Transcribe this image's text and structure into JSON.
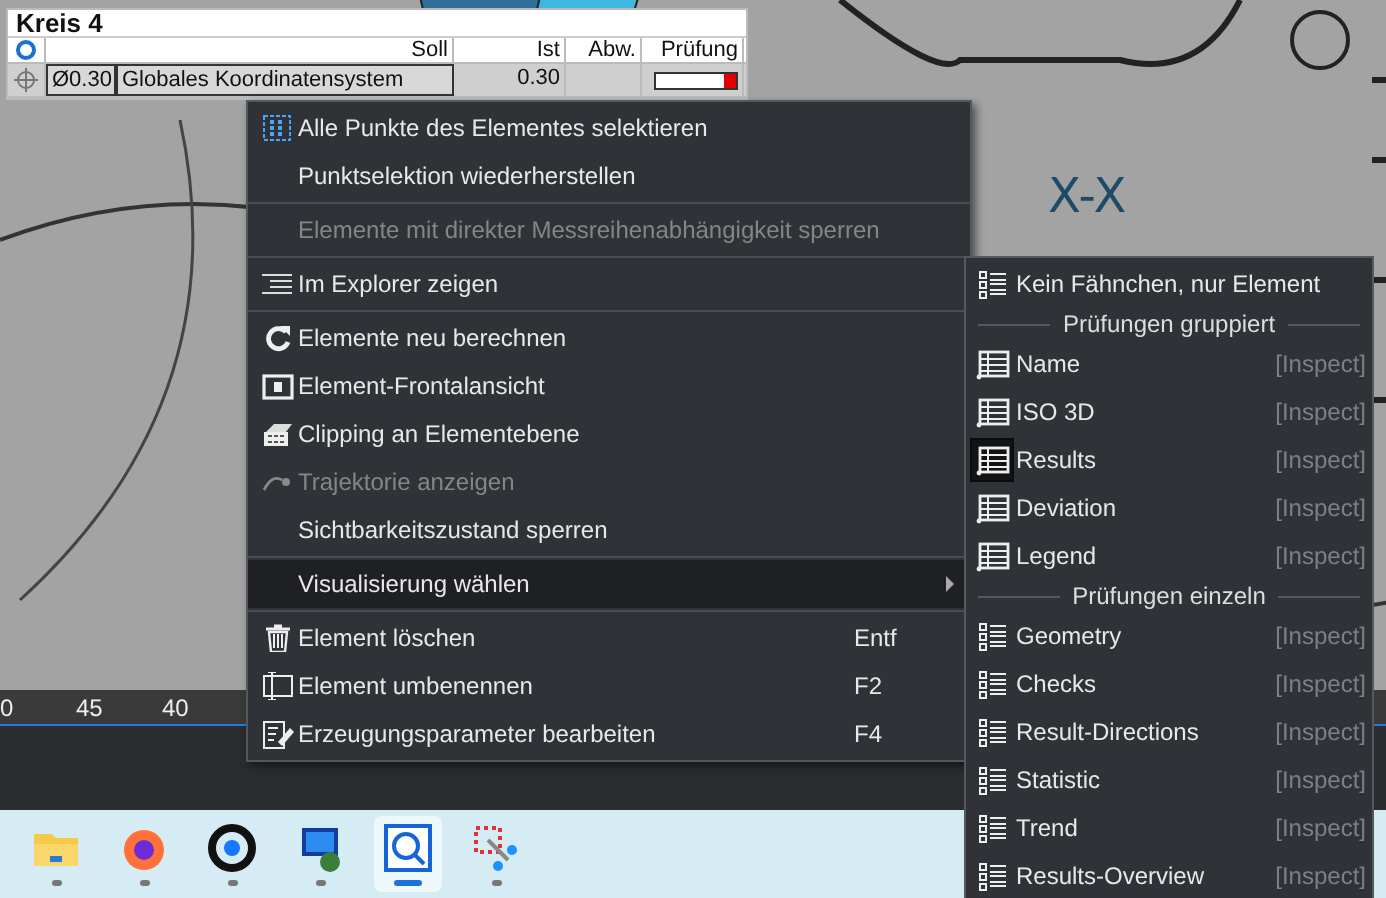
{
  "drawing": {
    "label": "X-X"
  },
  "element_panel": {
    "title": "Kreis 4",
    "columns": [
      "Soll",
      "Ist",
      "Abw.",
      "Prüfung"
    ],
    "row": {
      "tolerance": "Ø0.30",
      "system": "Globales Koordinatensystem",
      "actual": "0.30"
    }
  },
  "context_menu": {
    "items": [
      {
        "kind": "item",
        "label": "Alle Punkte des Elementes selektieren",
        "disabled": false,
        "selected": false,
        "submenu": false
      },
      {
        "kind": "item",
        "label": "Punktselektion wiederherstellen",
        "disabled": false,
        "selected": false,
        "submenu": false
      },
      {
        "kind": "separator"
      },
      {
        "kind": "item",
        "label": "Elemente mit direkter Messreihenabhängigkeit sperren",
        "disabled": true,
        "selected": false,
        "submenu": false
      },
      {
        "kind": "separator"
      },
      {
        "kind": "item",
        "label": "Im Explorer zeigen",
        "disabled": false,
        "selected": false,
        "submenu": false
      },
      {
        "kind": "separator"
      },
      {
        "kind": "item",
        "label": "Elemente neu berechnen",
        "disabled": false,
        "selected": false,
        "submenu": false
      },
      {
        "kind": "item",
        "label": "Element-Frontalansicht",
        "disabled": false,
        "selected": false,
        "submenu": false
      },
      {
        "kind": "item",
        "label": "Clipping an Elementebene",
        "disabled": false,
        "selected": false,
        "submenu": false
      },
      {
        "kind": "item",
        "label": "Trajektorie anzeigen",
        "disabled": true,
        "selected": false,
        "submenu": false
      },
      {
        "kind": "item",
        "label": "Sichtbarkeitszustand sperren",
        "disabled": false,
        "selected": false,
        "submenu": false
      },
      {
        "kind": "separator"
      },
      {
        "kind": "item",
        "label": "Visualisierung wählen",
        "disabled": false,
        "selected": true,
        "submenu": true
      },
      {
        "kind": "separator"
      },
      {
        "kind": "item",
        "label": "Element löschen",
        "shortcut": "Entf",
        "disabled": false,
        "selected": false,
        "submenu": false
      },
      {
        "kind": "item",
        "label": "Element umbenennen",
        "shortcut": "F2",
        "disabled": false,
        "selected": false,
        "submenu": false
      },
      {
        "kind": "item",
        "label": "Erzeugungsparameter bearbeiten",
        "shortcut": "F4",
        "disabled": false,
        "selected": false,
        "submenu": false
      }
    ]
  },
  "submenu": {
    "items": [
      {
        "kind": "item",
        "label": "Kein Fähnchen, nur Element",
        "selected": false
      },
      {
        "kind": "heading",
        "label": "Prüfungen gruppiert"
      },
      {
        "kind": "item",
        "label": "Name",
        "hint": "[Inspect]",
        "selected": false
      },
      {
        "kind": "item",
        "label": "ISO 3D",
        "hint": "[Inspect]",
        "selected": false
      },
      {
        "kind": "item",
        "label": "Results",
        "hint": "[Inspect]",
        "selected": true
      },
      {
        "kind": "item",
        "label": "Deviation",
        "hint": "[Inspect]",
        "selected": false
      },
      {
        "kind": "item",
        "label": "Legend",
        "hint": "[Inspect]",
        "selected": false
      },
      {
        "kind": "heading",
        "label": "Prüfungen einzeln"
      },
      {
        "kind": "item",
        "label": "Geometry",
        "hint": "[Inspect]",
        "selected": false
      },
      {
        "kind": "item",
        "label": "Checks",
        "hint": "[Inspect]",
        "selected": false
      },
      {
        "kind": "item",
        "label": "Result-Directions",
        "hint": "[Inspect]",
        "selected": false
      },
      {
        "kind": "item",
        "label": "Statistic",
        "hint": "[Inspect]",
        "selected": false
      },
      {
        "kind": "item",
        "label": "Trend",
        "hint": "[Inspect]",
        "selected": false
      },
      {
        "kind": "item",
        "label": "Results-Overview",
        "hint": "[Inspect]",
        "selected": false
      }
    ]
  },
  "ruler": {
    "labels": [
      "0",
      "45",
      "40"
    ]
  },
  "taskbar": {
    "apps": [
      {
        "selected": false
      },
      {
        "selected": false
      },
      {
        "selected": false
      },
      {
        "selected": false
      },
      {
        "selected": true
      },
      {
        "selected": false
      }
    ]
  }
}
